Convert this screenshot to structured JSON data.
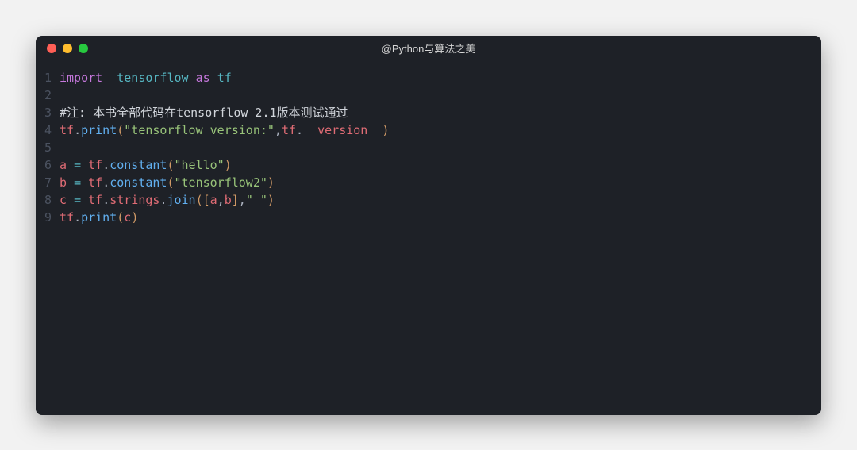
{
  "window": {
    "title": "@Python与算法之美"
  },
  "code": {
    "lines": [
      {
        "n": "1",
        "segments": [
          {
            "t": "import",
            "c": "kw"
          },
          {
            "t": "  ",
            "c": "code"
          },
          {
            "t": "tensorflow",
            "c": "mod"
          },
          {
            "t": " ",
            "c": "code"
          },
          {
            "t": "as",
            "c": "kw"
          },
          {
            "t": " ",
            "c": "code"
          },
          {
            "t": "tf",
            "c": "mod"
          }
        ]
      },
      {
        "n": "2",
        "segments": []
      },
      {
        "n": "3",
        "segments": [
          {
            "t": "#注: 本书全部代码在tensorflow 2.1版本测试通过",
            "c": "cmt"
          }
        ]
      },
      {
        "n": "4",
        "segments": [
          {
            "t": "tf",
            "c": "ident"
          },
          {
            "t": ".",
            "c": "dot"
          },
          {
            "t": "print",
            "c": "func"
          },
          {
            "t": "(",
            "c": "bracket"
          },
          {
            "t": "\"tensorflow version:\"",
            "c": "str"
          },
          {
            "t": ",",
            "c": "punc"
          },
          {
            "t": "tf",
            "c": "ident"
          },
          {
            "t": ".",
            "c": "dot"
          },
          {
            "t": "__version__",
            "c": "ident"
          },
          {
            "t": ")",
            "c": "bracket"
          }
        ]
      },
      {
        "n": "5",
        "segments": []
      },
      {
        "n": "6",
        "segments": [
          {
            "t": "a",
            "c": "ident"
          },
          {
            "t": " ",
            "c": "code"
          },
          {
            "t": "=",
            "c": "op"
          },
          {
            "t": " ",
            "c": "code"
          },
          {
            "t": "tf",
            "c": "ident"
          },
          {
            "t": ".",
            "c": "dot"
          },
          {
            "t": "constant",
            "c": "func"
          },
          {
            "t": "(",
            "c": "bracket"
          },
          {
            "t": "\"hello\"",
            "c": "str"
          },
          {
            "t": ")",
            "c": "bracket"
          }
        ]
      },
      {
        "n": "7",
        "segments": [
          {
            "t": "b",
            "c": "ident"
          },
          {
            "t": " ",
            "c": "code"
          },
          {
            "t": "=",
            "c": "op"
          },
          {
            "t": " ",
            "c": "code"
          },
          {
            "t": "tf",
            "c": "ident"
          },
          {
            "t": ".",
            "c": "dot"
          },
          {
            "t": "constant",
            "c": "func"
          },
          {
            "t": "(",
            "c": "bracket"
          },
          {
            "t": "\"tensorflow2\"",
            "c": "str"
          },
          {
            "t": ")",
            "c": "bracket"
          }
        ]
      },
      {
        "n": "8",
        "segments": [
          {
            "t": "c",
            "c": "ident"
          },
          {
            "t": " ",
            "c": "code"
          },
          {
            "t": "=",
            "c": "op"
          },
          {
            "t": " ",
            "c": "code"
          },
          {
            "t": "tf",
            "c": "ident"
          },
          {
            "t": ".",
            "c": "dot"
          },
          {
            "t": "strings",
            "c": "ident"
          },
          {
            "t": ".",
            "c": "dot"
          },
          {
            "t": "join",
            "c": "func"
          },
          {
            "t": "(",
            "c": "bracket"
          },
          {
            "t": "[",
            "c": "bracket"
          },
          {
            "t": "a",
            "c": "ident"
          },
          {
            "t": ",",
            "c": "punc"
          },
          {
            "t": "b",
            "c": "ident"
          },
          {
            "t": "]",
            "c": "bracket"
          },
          {
            "t": ",",
            "c": "punc"
          },
          {
            "t": "\" \"",
            "c": "str"
          },
          {
            "t": ")",
            "c": "bracket"
          }
        ]
      },
      {
        "n": "9",
        "segments": [
          {
            "t": "tf",
            "c": "ident"
          },
          {
            "t": ".",
            "c": "dot"
          },
          {
            "t": "print",
            "c": "func"
          },
          {
            "t": "(",
            "c": "bracket"
          },
          {
            "t": "c",
            "c": "ident"
          },
          {
            "t": ")",
            "c": "bracket"
          }
        ]
      }
    ]
  }
}
